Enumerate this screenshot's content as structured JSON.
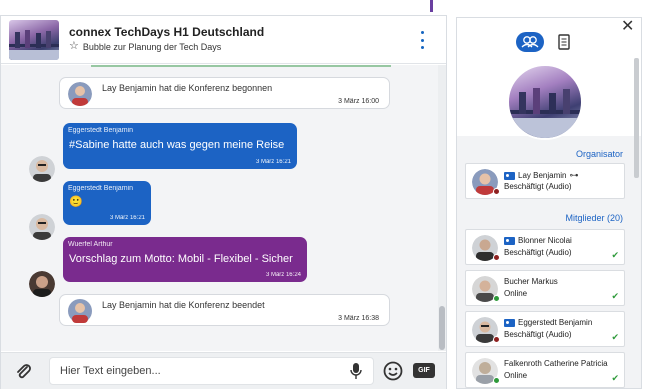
{
  "chat": {
    "title": "connex TechDays H1 Deutschland",
    "subtitle": "Bubble zur Planung der Tech Days",
    "messages": [
      {
        "type": "system",
        "text": "Lay Benjamin hat die Konferenz begonnen",
        "time": "3 März 16:00"
      },
      {
        "type": "bubble",
        "author": "Eggerstedt Benjamin",
        "text": "#Sabine hatte auch was gegen meine Reise",
        "time": "3 März 16:21"
      },
      {
        "type": "bubble",
        "author": "Eggerstedt Benjamin",
        "text": "🙂",
        "time": "3 März 16:21"
      },
      {
        "type": "bubble",
        "author": "Wuerfel Arthur",
        "text": "Vorschlag zum Motto: Mobil - Flexibel - Sicher",
        "time": "3 März 16:24"
      },
      {
        "type": "system",
        "text": "Lay Benjamin hat die Konferenz beendet",
        "time": "3 März 16:38"
      }
    ],
    "input_placeholder": "Hier Text eingeben...",
    "gif_label": "GIF"
  },
  "panel": {
    "organizer_label": "Organisator",
    "organizer": {
      "name": "Lay Benjamin",
      "status": "Beschäftigt (Audio)"
    },
    "members_label": "Mitglieder (20)",
    "members": [
      {
        "name": "Blonner Nicolai",
        "status": "Beschäftigt (Audio)"
      },
      {
        "name": "Bucher Markus",
        "status": "Online"
      },
      {
        "name": "Eggerstedt Benjamin",
        "status": "Beschäftigt (Audio)"
      },
      {
        "name": "Falkenroth Catherine Patricia",
        "status": "Online"
      }
    ]
  },
  "colors": {
    "accent": "#1c63c4",
    "purple": "#7a2b8e",
    "busy": "#8e2020",
    "online": "#2e9a3a"
  }
}
